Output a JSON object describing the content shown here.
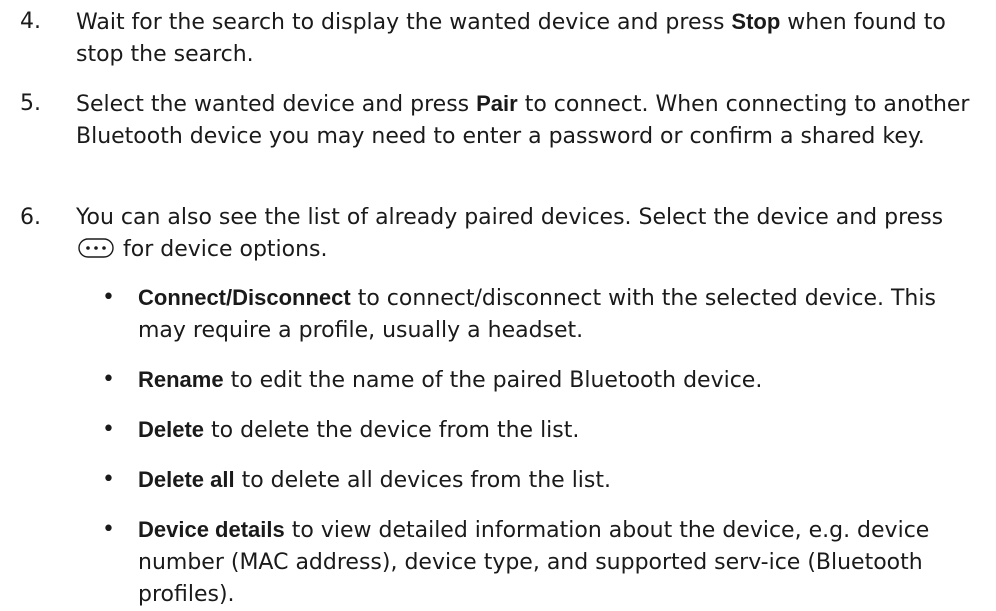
{
  "steps": [
    {
      "number": "4.",
      "t1": "Wait for the search to display the wanted device and press ",
      "kw1": "Stop",
      "t2": " when found to stop the search."
    },
    {
      "number": "5.",
      "t1": "Select the wanted device and press ",
      "kw1": "Pair",
      "t2": " to connect. When connecting to another Bluetooth device you may need to enter a password or confirm a shared key."
    },
    {
      "number": "6.",
      "t1": "You can also see the list of already paired devices. Select the device and press ",
      "icon": "more-options-icon",
      "t2": " for device options."
    }
  ],
  "bullets": [
    {
      "symbol": "•",
      "kw": "Connect/Disconnect",
      "text": " to connect/disconnect with the selected device. This may require a profile, usually a headset."
    },
    {
      "symbol": "•",
      "kw": "Rename",
      "text": " to edit the name of the paired Bluetooth device."
    },
    {
      "symbol": "•",
      "kw": "Delete",
      "text": " to delete the device from the list."
    },
    {
      "symbol": "•",
      "kw": "Delete all",
      "text": " to delete all devices from the list."
    },
    {
      "symbol": "•",
      "kw": "Device details",
      "text": " to view detailed information about the device, e.g. device number (MAC address), device type, and supported serv-ice (Bluetooth profiles)."
    }
  ]
}
